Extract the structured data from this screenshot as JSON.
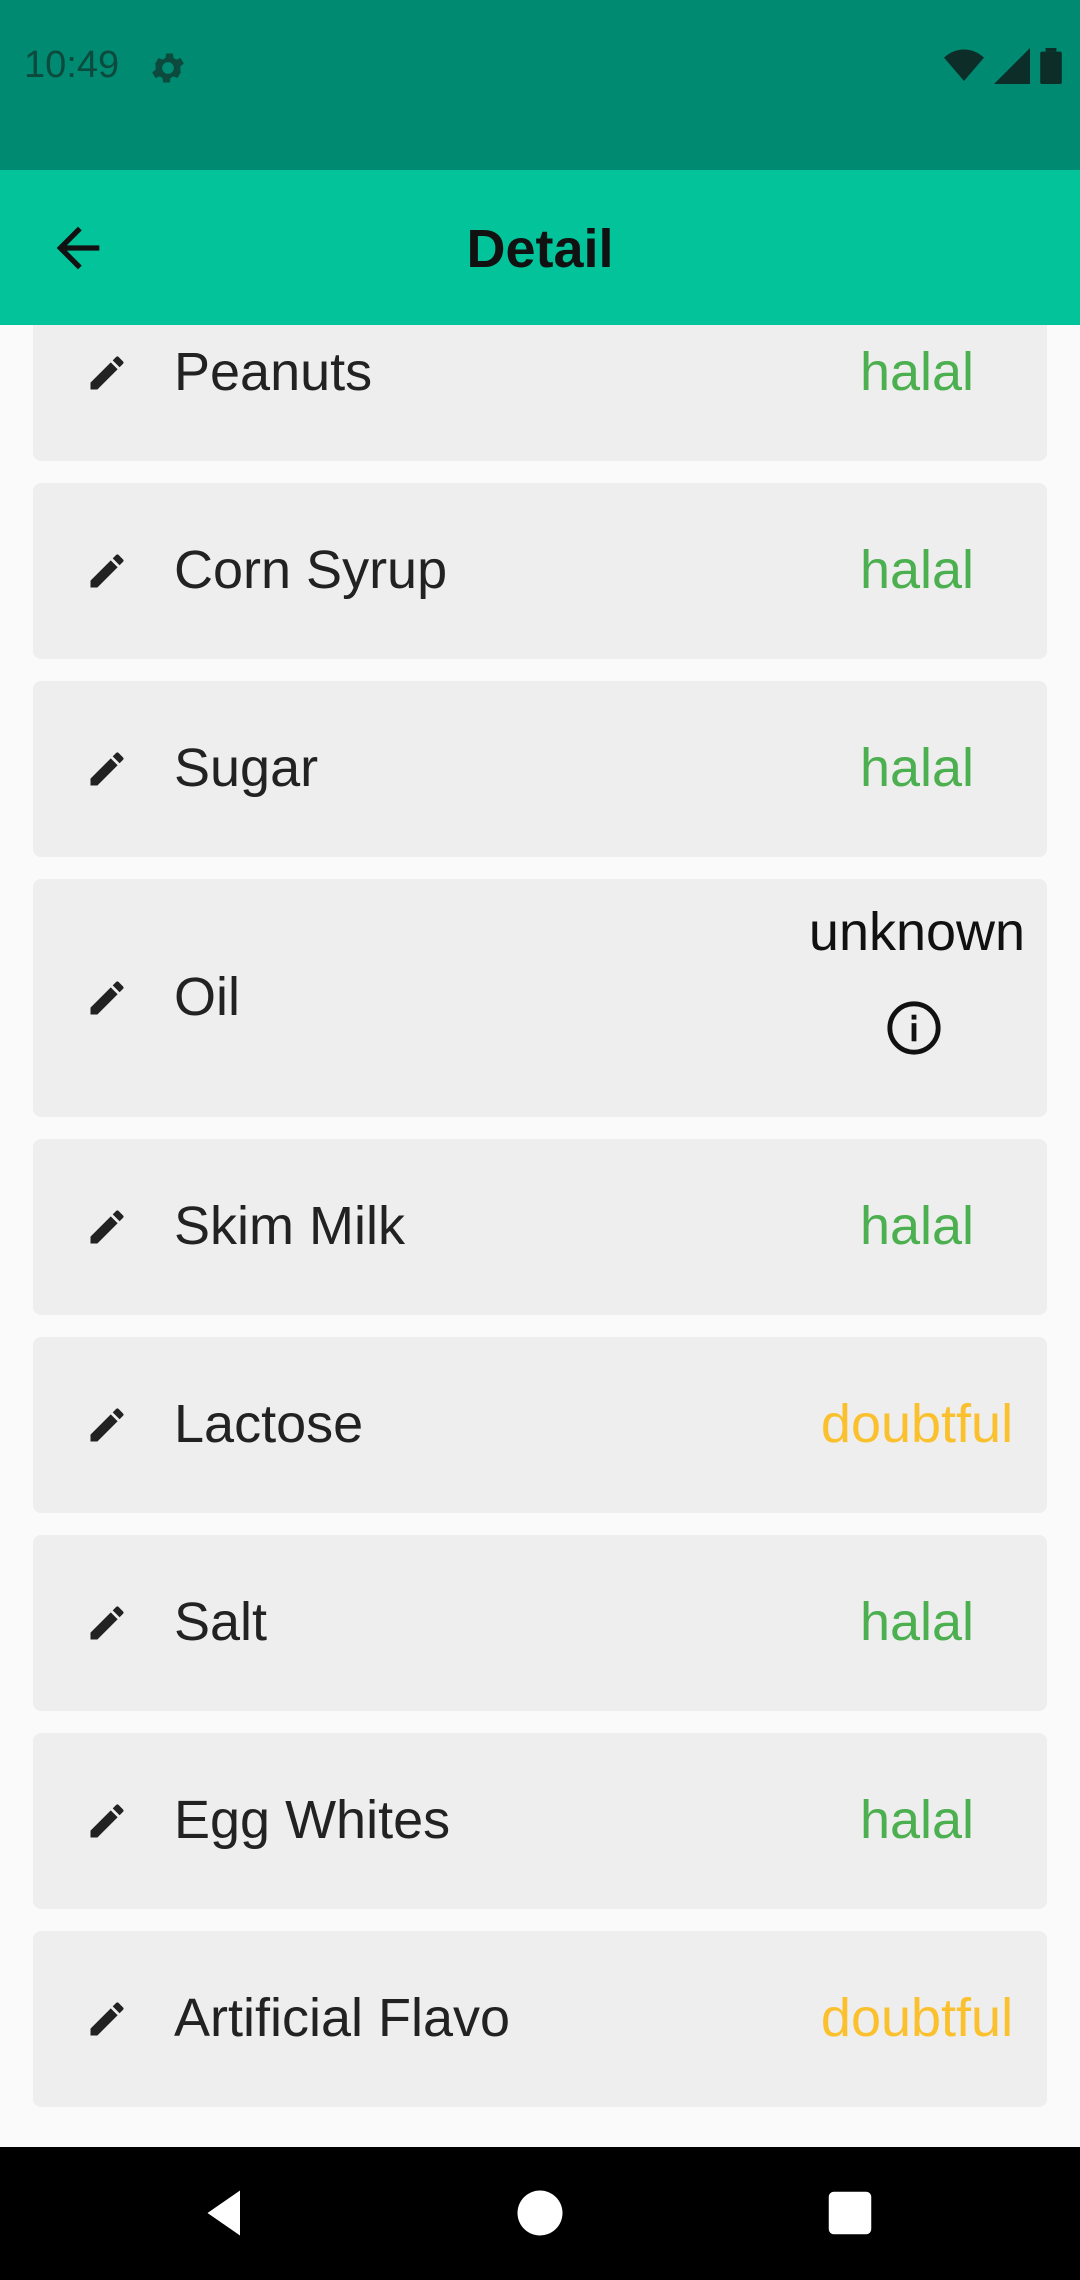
{
  "status_bar": {
    "time": "10:49"
  },
  "app_bar": {
    "title": "Detail"
  },
  "colors": {
    "halal": "#4caf50",
    "doubtful": "#fbc02d",
    "unknown": "#111111"
  },
  "ingredients": [
    {
      "name": "Peanuts",
      "status": "halal"
    },
    {
      "name": "Corn Syrup",
      "status": "halal"
    },
    {
      "name": "Sugar",
      "status": "halal"
    },
    {
      "name": "Oil",
      "status": "unknown"
    },
    {
      "name": "Skim Milk",
      "status": "halal"
    },
    {
      "name": "Lactose",
      "status": "doubtful"
    },
    {
      "name": "Salt",
      "status": "halal"
    },
    {
      "name": "Egg Whites",
      "status": "halal"
    },
    {
      "name": "Artificial Flavo",
      "status": "doubtful"
    }
  ]
}
